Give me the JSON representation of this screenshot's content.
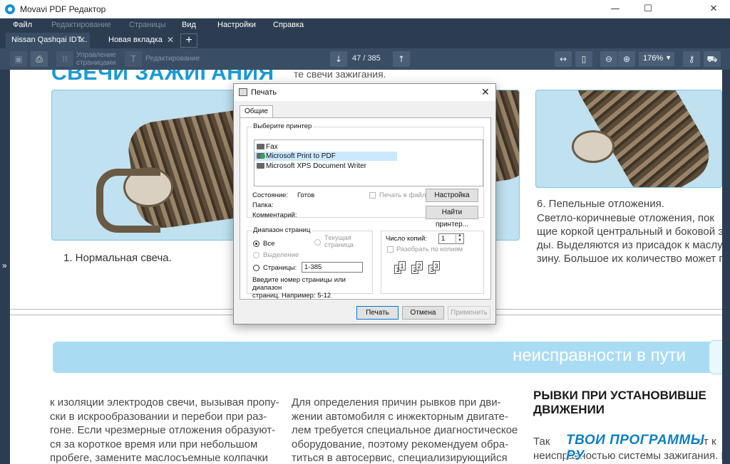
{
  "app": {
    "title": "Movavi PDF Редактор",
    "colors": {
      "chrome_dark": "#2c3d52",
      "toolbar": "#394d64",
      "accent": "#1a9ad6"
    }
  },
  "window_controls": {
    "minimize": "—",
    "maximize": "☐",
    "close": "✕"
  },
  "menu": [
    {
      "label": "Файл",
      "enabled": true
    },
    {
      "label": "Редактирование",
      "enabled": false
    },
    {
      "label": "Страницы",
      "enabled": false
    },
    {
      "label": "Вид",
      "enabled": true
    },
    {
      "label": "Настройки",
      "enabled": true
    },
    {
      "label": "Справка",
      "enabled": true
    }
  ],
  "tabs": [
    {
      "label": "Nissan Qashqai IDT...",
      "active": true
    },
    {
      "label": "Новая вкладка",
      "active": false
    }
  ],
  "toolbar": {
    "manage_pages_line1": "Управление",
    "manage_pages_line2": "страницами",
    "edit_label": "Редактирование",
    "page_current": "47",
    "page_total": "385",
    "page_separator": "/",
    "zoom": "176%"
  },
  "document": {
    "headline": "СВЕЧИ ЗАЖИГАНИЯ",
    "top_snippet": "те свечи зажигания.",
    "caption_left": "1. Нормальная свеча.",
    "right_paragraph": [
      "6. Пепельные отложения.",
      "   Светло-коричневые отложения, пок",
      "щие коркой центральный и боковой э",
      "ды. Выделяются из присадок к маслу и",
      "зину. Большое их количество может п"
    ],
    "banner": "неисправности в пути",
    "col1": [
      "к изоляции электродов свечи, вызывая пропу-",
      "ски в искрообразовании и перебои при раз-",
      "гоне. Если чрезмерные отложения образуют-",
      "ся за короткое время или при небольшом",
      "пробеге, замените маслосъемные колпачки"
    ],
    "col2": [
      "   Для определения причин рывков при дви-",
      "жении автомобиля с инжекторным двигате-",
      "лем требуется специальное диагностическое",
      "оборудование, поэтому рекомендуем обра-",
      "титься в автосервис, специализирующийся"
    ],
    "heading_right_1": "РЫВКИ ПРИ УСТАНОВИВШЕ",
    "heading_right_2": "ДВИЖЕНИИ",
    "col3": [
      "   Так",
      "неисправностью системы зажигания. К"
    ],
    "col3_end": "ют к",
    "watermark": "ТВОИ ПРОГРАММЫ РУ"
  },
  "print_dialog": {
    "title": "Печать",
    "close": "✕",
    "tab": "Общие",
    "printer_group": "Выберите принтер",
    "printers": [
      {
        "name": "Fax",
        "selected": false
      },
      {
        "name": "Microsoft Print to PDF",
        "selected": true
      },
      {
        "name": "Microsoft XPS Document Writer",
        "selected": false
      }
    ],
    "status_label": "Состояние:",
    "status_value": "Готов",
    "folder_label": "Папка:",
    "comment_label": "Комментарий:",
    "print_to_file": "Печать в файл",
    "settings_button": "Настройка",
    "find_printer_button": "Найти принтер...",
    "range_group": "Диапазон страниц",
    "range_all": "Все",
    "range_current_line1": "Текущая",
    "range_current_line2": "страница",
    "range_selection": "Выделение",
    "range_pages": "Страницы:",
    "range_pages_value": "1-385",
    "range_hint_line1": "Введите номер страницы или диапазон",
    "range_hint_line2": "страниц.  Например: 5-12",
    "copies_label": "Число копий:",
    "copies_value": "1",
    "collate_label": "Разобрать по копиям",
    "print_button": "Печать",
    "cancel_button": "Отмена",
    "apply_button": "Применить"
  }
}
